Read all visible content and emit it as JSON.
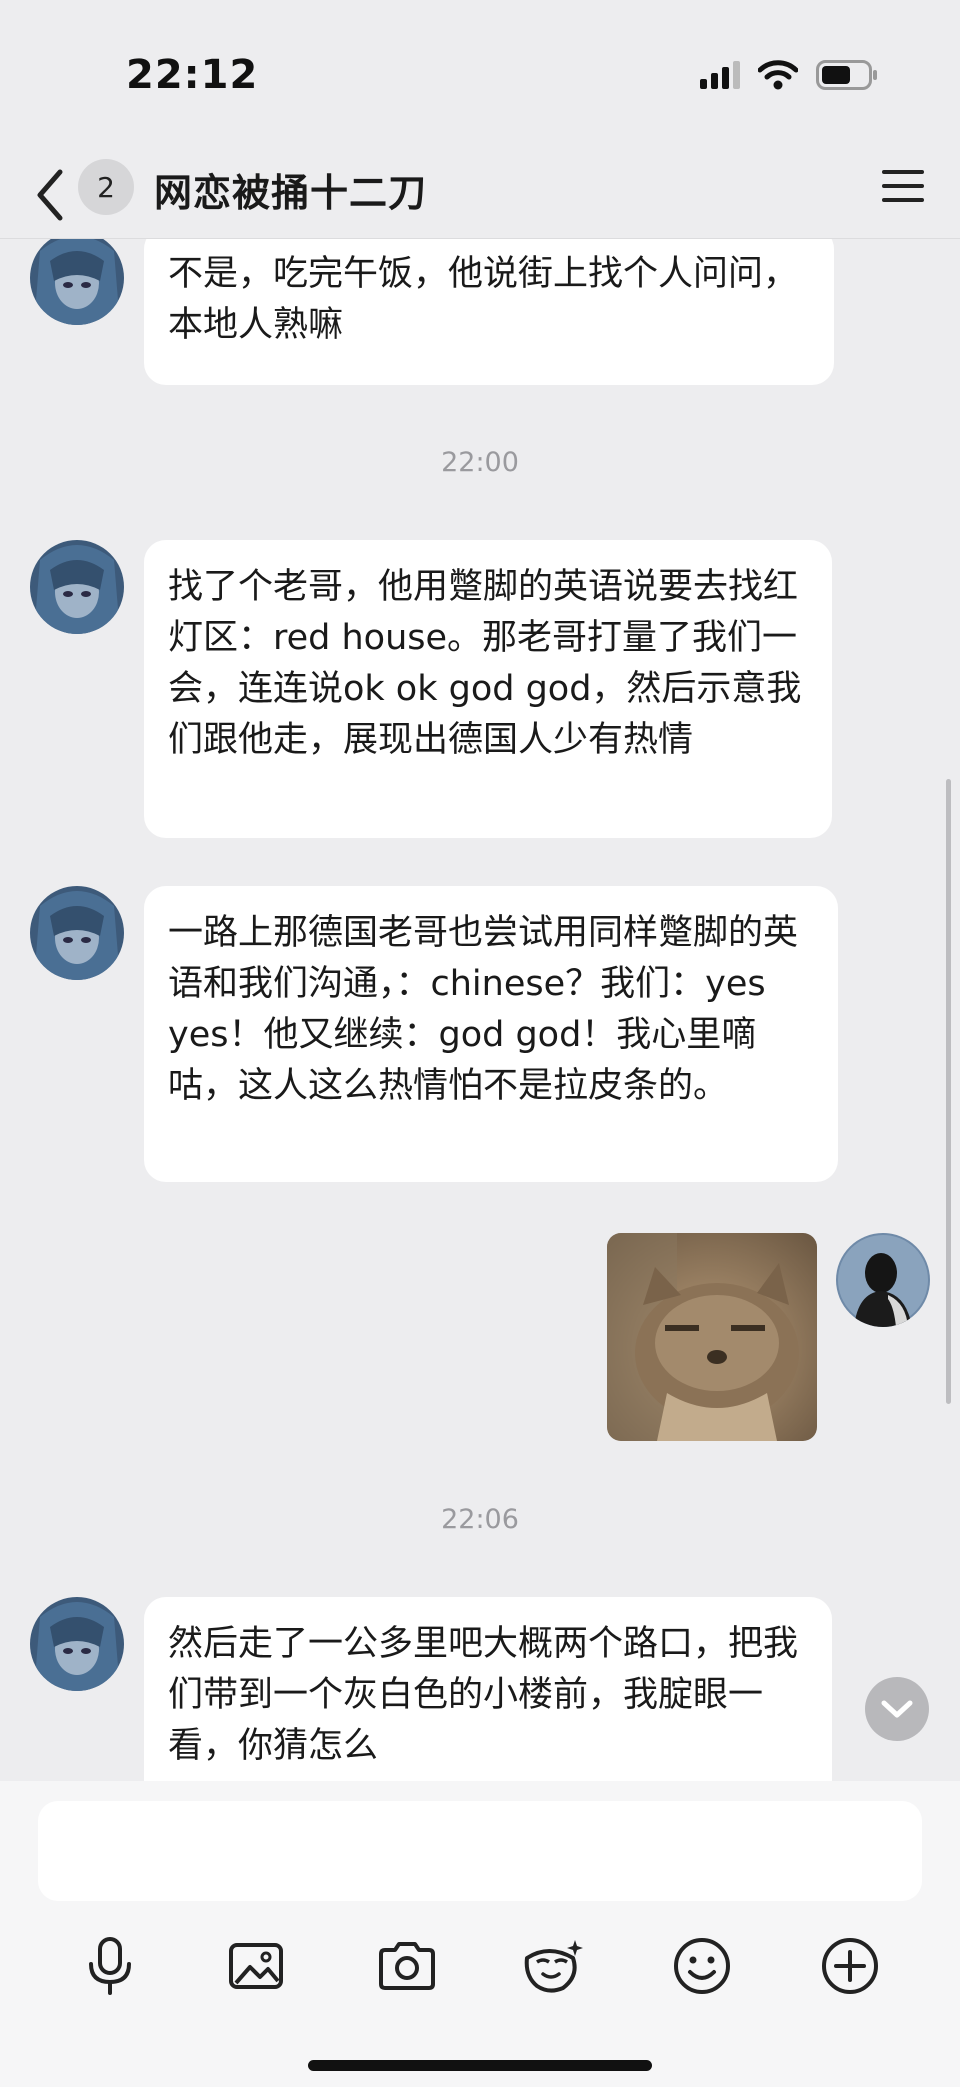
{
  "status_bar": {
    "time": "22:12"
  },
  "header": {
    "unread_count": "2",
    "title": "网恋被捅十二刀"
  },
  "messages": [
    {
      "from": "other",
      "text": "不是，吃完午饭，他说街上找个人问问，本地人熟嘛"
    },
    {
      "timestamp": "22:00"
    },
    {
      "from": "other",
      "text": "找了个老哥，他用蹩脚的英语说要去找红灯区：red  house。那老哥打量了我们一会，连连说ok ok god god，然后示意我们跟他走，展现出德国人少有热情"
    },
    {
      "from": "other",
      "text": "一路上那德国老哥也尝试用同样蹩脚的英语和我们沟通，：chinese？我们：yes yes！他又继续：god god！我心里嘀咕，这人这么热情怕不是拉皮条的。"
    },
    {
      "from": "self",
      "image": "cat-meme"
    },
    {
      "timestamp": "22:06"
    },
    {
      "from": "other",
      "text": "然后走了一公多里吧大概两个路口，把我们带到一个灰白色的小楼前，我腚眼一看，你猜怎么"
    }
  ],
  "input": {
    "placeholder": ""
  },
  "toolbar": {
    "icons": [
      "microphone-icon",
      "image-icon",
      "camera-icon",
      "sticker-icon",
      "emoji-icon",
      "plus-icon"
    ]
  },
  "colors": {
    "background": "#ededef",
    "bubble": "#ffffff",
    "timestamp": "#9a9a9e"
  }
}
